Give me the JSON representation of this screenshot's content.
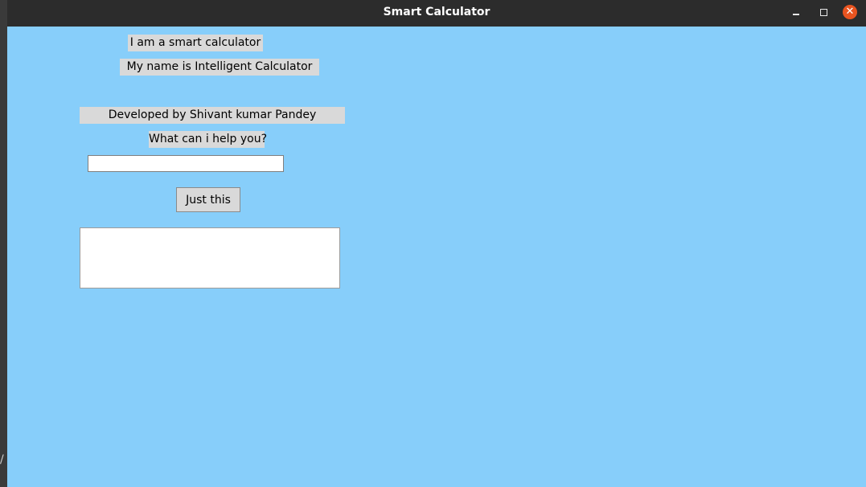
{
  "window": {
    "title": "Smart Calculator",
    "close_glyph": "✕"
  },
  "desktop": {
    "edge_mark": "/"
  },
  "app": {
    "intro_label": "I am a smart calculator",
    "name_label": "My name is Intelligent Calculator",
    "developer_label": "Developed by Shivant kumar Pandey",
    "prompt_label": "What can i help you?",
    "input_value": "",
    "submit_button_label": "Just this",
    "output_value": ""
  },
  "colors": {
    "background": "#87cefa",
    "label_bg": "#d9d9d9",
    "close_button": "#e95420"
  }
}
